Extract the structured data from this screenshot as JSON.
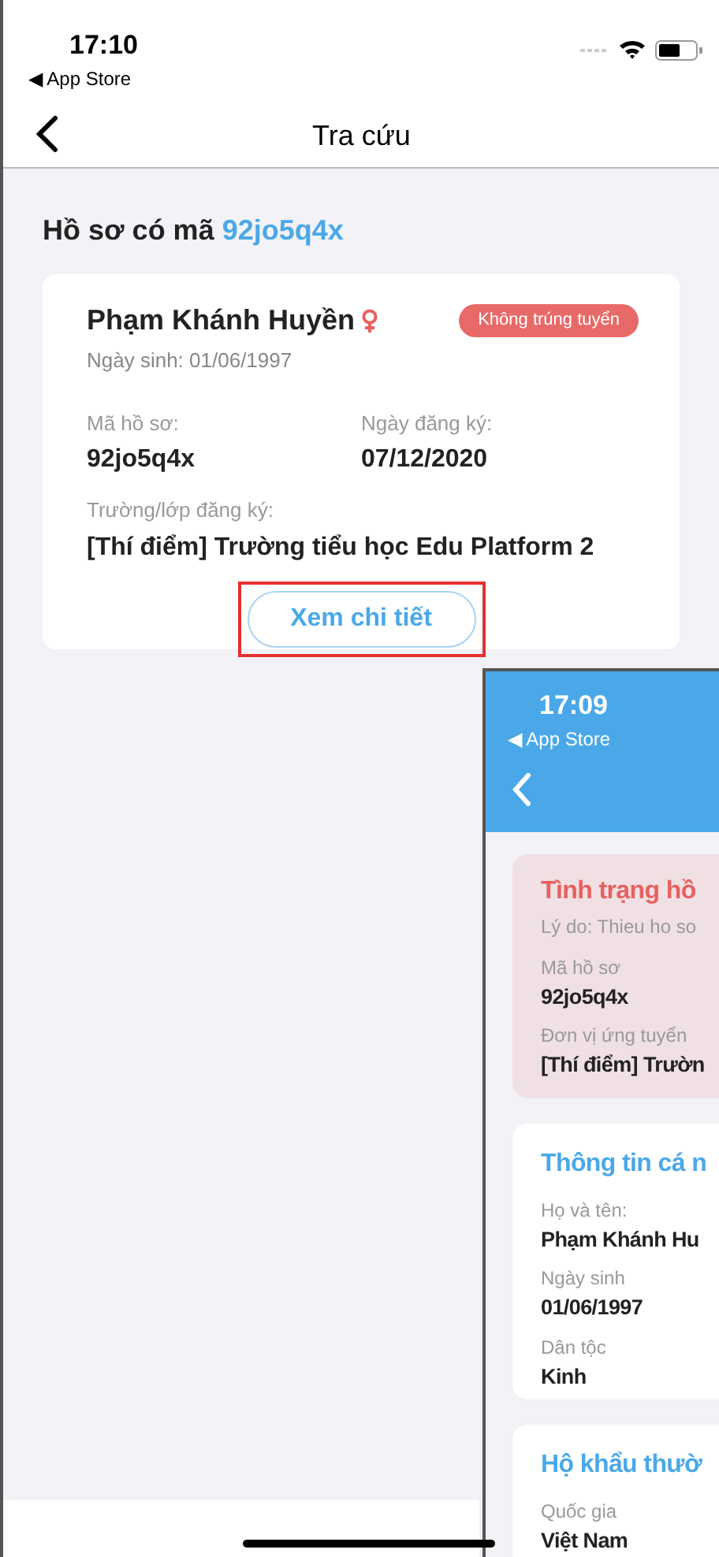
{
  "status_bar": {
    "time": "17:10",
    "back_app": "◀ App Store"
  },
  "nav": {
    "title": "Tra cứu"
  },
  "heading": {
    "prefix": "Hồ sơ có mã",
    "code": "92jo5q4x"
  },
  "record": {
    "name": "Phạm Khánh Huyền",
    "birth": "Ngày sinh: 01/06/1997",
    "status": "Không trúng tuyển",
    "fields": [
      {
        "label": "Mã hồ sơ:",
        "value": "92jo5q4x"
      },
      {
        "label": "Ngày đăng ký:",
        "value": "07/12/2020"
      }
    ],
    "school": {
      "label": "Trường/lớp đăng ký:",
      "value": "[Thí điểm] Trường tiểu học Edu Platform 2"
    },
    "button": {
      "label": "Xem chi tiết",
      "highlighted": true
    }
  },
  "inset": {
    "status_bar": {
      "time": "17:09",
      "back_app": "◀ App Store"
    },
    "status_card": {
      "title": "Tình trạng hồ",
      "reason": "Lý do: Thieu ho so",
      "fields": [
        {
          "label": "Mã hồ sơ",
          "value": "92jo5q4x"
        },
        {
          "label": "Đơn vị ứng tuyển",
          "value": "[Thí điểm] Trườn"
        }
      ]
    },
    "sections": [
      {
        "title": "Thông tin cá n",
        "fields": [
          {
            "label": "Họ và tên:",
            "value": "Phạm Khánh Hu"
          },
          {
            "label": "Ngày sinh",
            "value": "01/06/1997"
          },
          {
            "label": "Dân tộc",
            "value": "Kinh"
          }
        ]
      },
      {
        "title": "Hộ khẩu thườ",
        "fields": [
          {
            "label": "Quốc gia",
            "value": "Việt Nam"
          }
        ]
      }
    ]
  }
}
